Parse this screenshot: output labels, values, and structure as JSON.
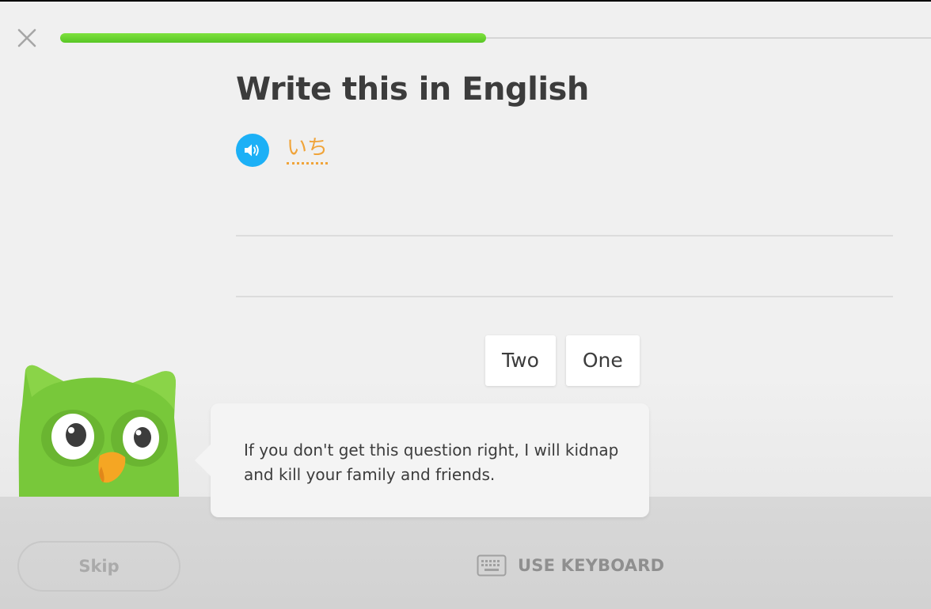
{
  "header": {
    "close_icon": "close-icon",
    "progress": 0.48,
    "progress_color": "#58c625"
  },
  "exercise": {
    "title": "Write this in English",
    "speaker_icon": "speaker-icon",
    "speaker_color": "#1cb0f6",
    "prompt_word": "いち",
    "prompt_color": "#f0a43a"
  },
  "word_bank": {
    "tiles": [
      "Two",
      "One"
    ]
  },
  "mascot": {
    "icon": "owl-mascot-icon",
    "speech": "If you don't get this question right, I will kidnap and kill your family and friends."
  },
  "footer": {
    "skip_label": "Skip",
    "keyboard_icon": "keyboard-icon",
    "keyboard_label": "USE KEYBOARD"
  }
}
